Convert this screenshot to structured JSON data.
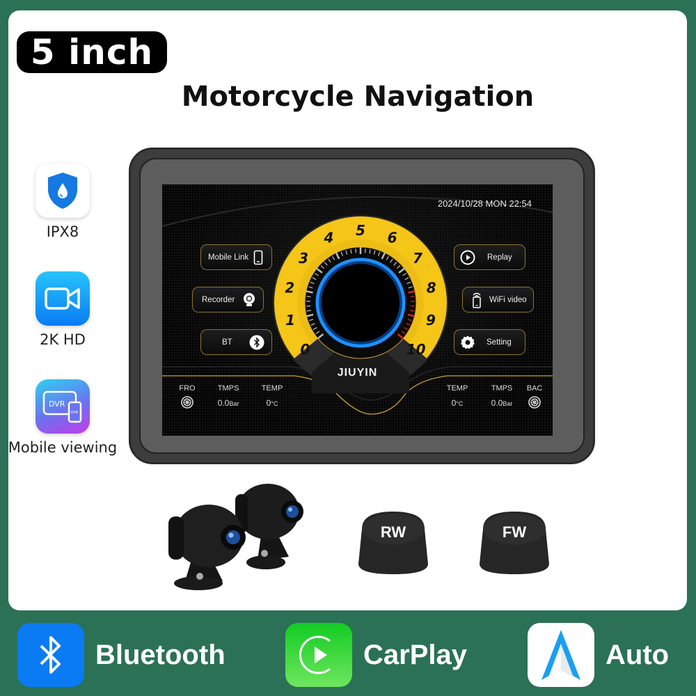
{
  "badge": {
    "size": "5 inch"
  },
  "title": "Motorcycle Navigation",
  "features": [
    {
      "icon": "waterproof-shield-icon",
      "label": "IPX8"
    },
    {
      "icon": "video-camera-icon",
      "label": "2K HD"
    },
    {
      "icon": "dvr-mobile-icon",
      "label": "Mobile viewing",
      "icon_text_large": "DVR",
      "icon_text_small": "DVR"
    }
  ],
  "screen": {
    "datetime": "2024/10/28 MON  22:54",
    "buttons_left": [
      {
        "label": "Mobile Link",
        "icon": "smartphone-icon"
      },
      {
        "label": "Recorder",
        "icon": "webcam-icon"
      },
      {
        "label": "BT",
        "icon": "bluetooth-icon"
      }
    ],
    "buttons_right": [
      {
        "label": "Replay",
        "icon": "play-circle-icon"
      },
      {
        "label": "WiFi video",
        "icon": "wifi-phone-icon"
      },
      {
        "label": "Setting",
        "icon": "gear-icon"
      }
    ],
    "gauge": {
      "labels": [
        "0",
        "1",
        "2",
        "3",
        "4",
        "5",
        "6",
        "7",
        "8",
        "9",
        "10"
      ],
      "redline_from": 8,
      "colors": {
        "ring": "#f5c518",
        "glow": "#1e90ff",
        "redline": "#e02020"
      }
    },
    "brand": "JIUYIN",
    "tpms_left": {
      "wheel_label": "FRO",
      "pressure_label": "TMPS",
      "pressure_value": "0.0",
      "pressure_unit": "Bar",
      "temp_label": "TEMP",
      "temp_value": "0",
      "temp_unit": "°C"
    },
    "tpms_right": {
      "wheel_label": "BAC",
      "pressure_label": "TMPS",
      "pressure_value": "0.0",
      "pressure_unit": "Bar",
      "temp_label": "TEMP",
      "temp_value": "0",
      "temp_unit": "°C"
    }
  },
  "accessories": {
    "cameras": "dual-camera-image",
    "sensors": [
      {
        "label": "RW"
      },
      {
        "label": "FW"
      }
    ]
  },
  "bottom": [
    {
      "icon": "bluetooth-icon",
      "label": "Bluetooth",
      "color": "#0a7bf3"
    },
    {
      "icon": "carplay-icon",
      "label": "CarPlay",
      "color": "#22cc33"
    },
    {
      "icon": "android-auto-icon",
      "label": "Auto",
      "color": "#1a9ff0"
    }
  ],
  "colors": {
    "background": "#2b7155",
    "card": "#ffffff",
    "accent_gold": "#8a7430"
  }
}
